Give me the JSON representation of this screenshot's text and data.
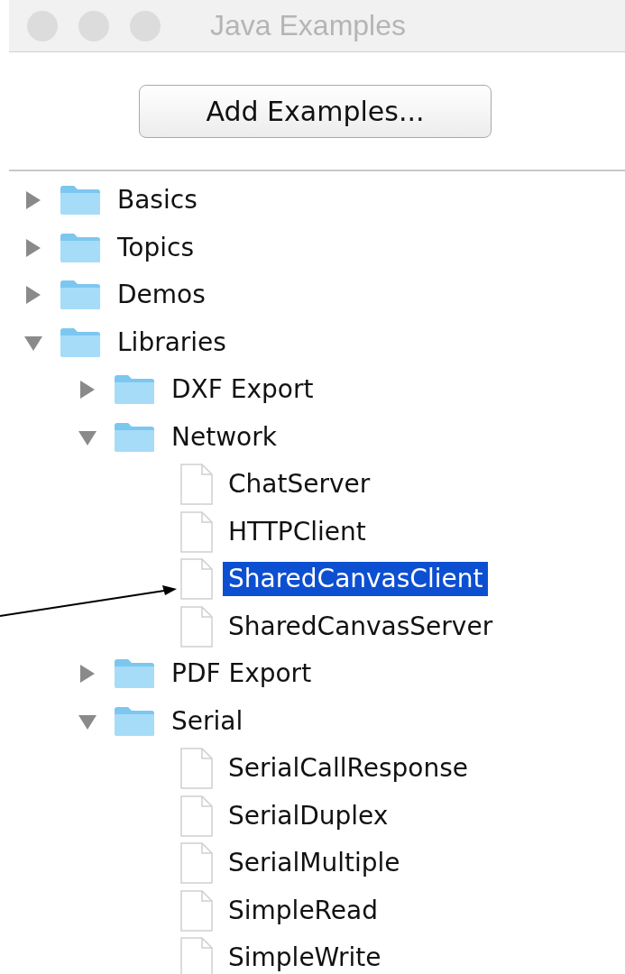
{
  "window": {
    "title": "Java Examples"
  },
  "button": {
    "label": "Add Examples..."
  },
  "tree": [
    {
      "kind": "folder",
      "label": "Basics",
      "expanded": false,
      "selected": false
    },
    {
      "kind": "folder",
      "label": "Topics",
      "expanded": false,
      "selected": false
    },
    {
      "kind": "folder",
      "label": "Demos",
      "expanded": false,
      "selected": false
    },
    {
      "kind": "folder",
      "label": "Libraries",
      "expanded": true,
      "selected": false,
      "children": [
        {
          "kind": "folder",
          "label": "DXF Export",
          "expanded": false,
          "selected": false
        },
        {
          "kind": "folder",
          "label": "Network",
          "expanded": true,
          "selected": false,
          "children": [
            {
              "kind": "file",
              "label": "ChatServer",
              "selected": false
            },
            {
              "kind": "file",
              "label": "HTTPClient",
              "selected": false
            },
            {
              "kind": "file",
              "label": "SharedCanvasClient",
              "selected": true
            },
            {
              "kind": "file",
              "label": "SharedCanvasServer",
              "selected": false
            }
          ]
        },
        {
          "kind": "folder",
          "label": "PDF Export",
          "expanded": false,
          "selected": false
        },
        {
          "kind": "folder",
          "label": "Serial",
          "expanded": true,
          "selected": false,
          "children": [
            {
              "kind": "file",
              "label": "SerialCallResponse",
              "selected": false
            },
            {
              "kind": "file",
              "label": "SerialDuplex",
              "selected": false
            },
            {
              "kind": "file",
              "label": "SerialMultiple",
              "selected": false
            },
            {
              "kind": "file",
              "label": "SimpleRead",
              "selected": false
            },
            {
              "kind": "file",
              "label": "SimpleWrite",
              "selected": false
            }
          ]
        }
      ]
    }
  ]
}
